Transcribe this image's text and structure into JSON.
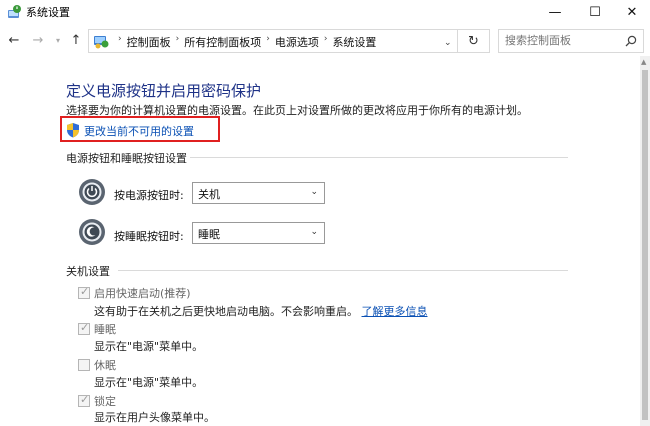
{
  "window": {
    "title": "系统设置",
    "minimize_glyph": "—",
    "maximize_glyph": "☐",
    "close_glyph": "✕"
  },
  "nav": {
    "back_glyph": "←",
    "forward_glyph": "→",
    "recent_glyph": "▾",
    "up_glyph": "↑",
    "breadcrumbs": [
      "控制面板",
      "所有控制面板项",
      "电源选项",
      "系统设置"
    ],
    "refresh_glyph": "↻",
    "search_placeholder": "搜索控制面板"
  },
  "page": {
    "title": "定义电源按钮并启用密码保护",
    "description": "选择要为你的计算机设置的电源设置。在此页上对设置所做的更改将应用于你所有的电源计划。",
    "change_settings_link": "更改当前不可用的设置"
  },
  "buttons_section": {
    "heading": "电源按钮和睡眠按钮设置",
    "power_button": {
      "label": "按电源按钮时:",
      "value": "关机"
    },
    "sleep_button": {
      "label": "按睡眠按钮时:",
      "value": "睡眠"
    }
  },
  "shutdown_section": {
    "heading": "关机设置",
    "items": [
      {
        "label": "启用快速启动(推荐)",
        "checked": true,
        "desc": "这有助于在关机之后更快地启动电脑。不会影响重启。",
        "link": "了解更多信息"
      },
      {
        "label": "睡眠",
        "checked": true,
        "desc": "显示在\"电源\"菜单中。"
      },
      {
        "label": "休眠",
        "checked": false,
        "desc": "显示在\"电源\"菜单中。"
      },
      {
        "label": "锁定",
        "checked": true,
        "desc": "显示在用户头像菜单中。"
      }
    ]
  },
  "colors": {
    "title_blue": "#1e3287",
    "link_blue": "#0a50b4",
    "highlight_red": "#e02020"
  }
}
